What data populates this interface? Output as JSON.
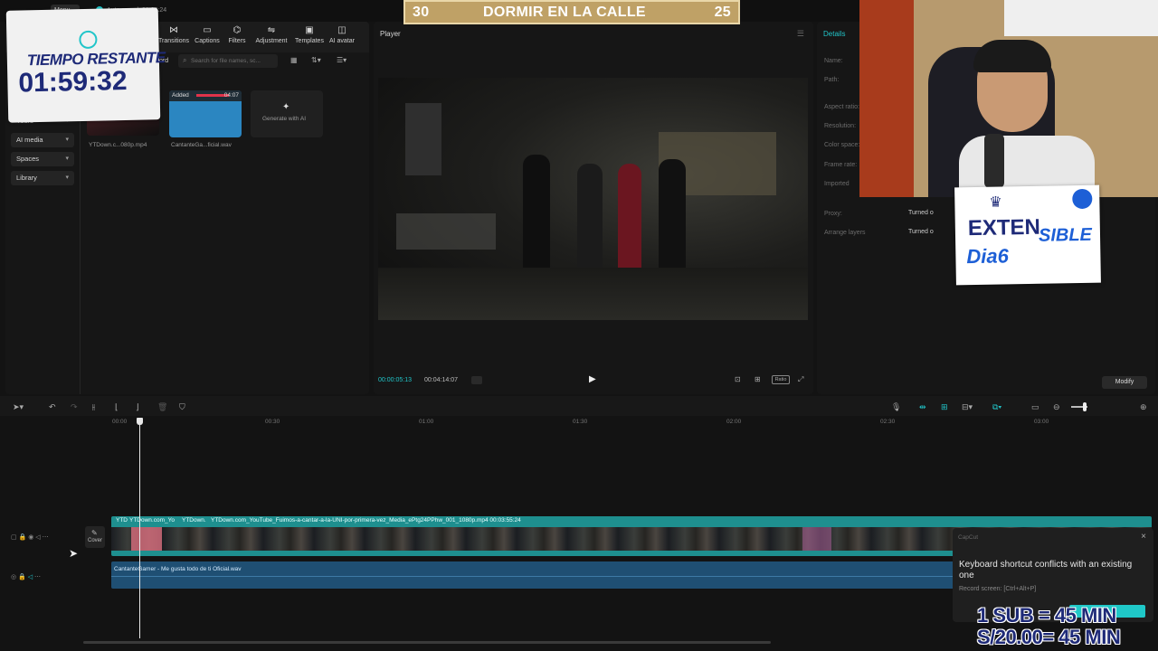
{
  "topbar": {
    "menu_label": "Menu",
    "autosave": "Auto saved: 21:08:24"
  },
  "toolbar": {
    "tools": [
      {
        "label": "Transitions",
        "icon": "transitions-icon"
      },
      {
        "label": "Captions",
        "icon": "captions-icon"
      },
      {
        "label": "Filters",
        "icon": "filters-icon"
      },
      {
        "label": "Adjustment",
        "icon": "adjustment-icon"
      },
      {
        "label": "Templates",
        "icon": "templates-icon"
      },
      {
        "label": "AI avatar",
        "icon": "ai-avatar-icon"
      }
    ]
  },
  "sidebar": {
    "items": [
      {
        "label": "Yours"
      },
      {
        "label": "AI media"
      },
      {
        "label": "Spaces"
      },
      {
        "label": "Library"
      }
    ]
  },
  "media": {
    "record_label": "ord",
    "search_placeholder": "Search for file names, sc...",
    "items": [
      {
        "name": "YTDown.c...080p.mp4"
      },
      {
        "name": "CantanteGa...ficial.wav",
        "badge": "Added",
        "duration": "04:07"
      }
    ],
    "generate_label": "Generate with AI"
  },
  "player": {
    "title": "Player",
    "current_time": "00:00:05:13",
    "total_time": "00:04:14:07",
    "ratio_label": "Ratio"
  },
  "details": {
    "title": "Details",
    "fields": [
      "Name:",
      "Path:",
      "Aspect ratio:",
      "Resolution:",
      "Color space:",
      "Frame rate:",
      "Imported"
    ],
    "proxy_label": "Proxy:",
    "proxy_value": "Turned o",
    "arrange_label": "Arrange layers",
    "arrange_value": "Turned o",
    "modify_label": "Modify"
  },
  "timeline": {
    "ruler": [
      "00:00",
      "00:30",
      "01:00",
      "01:30",
      "02:00",
      "02:30",
      "03:00"
    ],
    "cover_label": "Cover",
    "video_clip_label": "YTDown.com_YouTube_Fuimos-a-cantar-a-la-UNI-por-primera-vez_Media_ePtg24PPhw_001_1080p.mp4   00:03:55:24",
    "video_clip_short1": "YTD",
    "video_clip_short2": "YTDown.com_Yo",
    "video_clip_short3": "YTDown.",
    "audio_clip_label": "CantanteGamer - Me gusta todo de ti Oficial.wav"
  },
  "toast": {
    "app": "CapCut",
    "message": "Keyboard shortcut conflicts with an existing one",
    "detail": "Record screen: [Ctrl+Alt+P]"
  },
  "overlays": {
    "timer_title": "TIEMPO RESTANTE",
    "timer_value": "01:59:32",
    "banner_left": "30",
    "banner_center": "DORMIR EN LA CALLE",
    "banner_right": "25",
    "sticker_line1": "EXTEN",
    "sticker_line1b": "SIBLE",
    "sticker_line2": "Dia6",
    "sub_line1": "1 SUB = 45 MIN",
    "sub_line2": "S/20.00= 45 MIN"
  },
  "colors": {
    "accent": "#21c5c9",
    "video_track": "#1e8f8f",
    "audio_track": "#1f4f73",
    "banner": "#bfa166"
  }
}
